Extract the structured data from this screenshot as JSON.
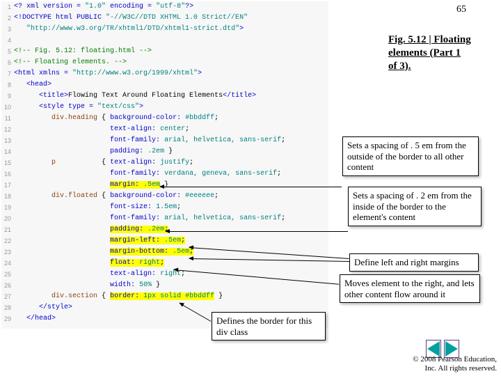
{
  "slide_number": "65",
  "figure_caption": "Fig. 5.12 | Floating elements (Part 1 of 3).",
  "code_lines": [
    {
      "n": "1",
      "html": "<span class='c-blue'>&lt;? xml version = </span><span class='c-teal'>\"1.0\"</span><span class='c-blue'> encoding = </span><span class='c-teal'>\"utf-8\"</span><span class='c-blue'>?&gt;</span>"
    },
    {
      "n": "2",
      "html": "<span class='c-blue'>&lt;!DOCTYPE html PUBLIC </span><span class='c-teal'>\"-//W3C//DTD XHTML 1.0 Strict//EN\"</span>"
    },
    {
      "n": "3",
      "html": "   <span class='c-teal'>\"http://www.w3.org/TR/xhtml1/DTD/xhtml1-strict.dtd\"</span><span class='c-blue'>&gt;</span>"
    },
    {
      "n": "4",
      "html": ""
    },
    {
      "n": "5",
      "html": "<span class='c-green'>&lt;!-- Fig. 5.12: floating.html --&gt;</span>"
    },
    {
      "n": "6",
      "html": "<span class='c-green'>&lt;!-- Floating elements. --&gt;</span>"
    },
    {
      "n": "7",
      "html": "<span class='c-blue'>&lt;html xmlns = </span><span class='c-teal'>\"http://www.w3.org/1999/xhtml\"</span><span class='c-blue'>&gt;</span>"
    },
    {
      "n": "8",
      "html": "   <span class='c-blue'>&lt;head&gt;</span>"
    },
    {
      "n": "9",
      "html": "      <span class='c-blue'>&lt;title&gt;</span><span class='c-black'>Flowing Text Around Floating Elements</span><span class='c-blue'>&lt;/title&gt;</span>"
    },
    {
      "n": "10",
      "html": "      <span class='c-blue'>&lt;style type = </span><span class='c-teal'>\"text/css\"</span><span class='c-blue'>&gt;</span>"
    },
    {
      "n": "11",
      "html": "         <span class='c-brown'>div.heading</span> <span class='c-black'>{</span> <span class='c-blue'>background-color:</span> <span class='c-teal'>#bbddff</span><span class='c-black'>;</span>"
    },
    {
      "n": "12",
      "html": "                       <span class='c-blue'>text-align:</span> <span class='c-teal'>center</span><span class='c-black'>;</span>"
    },
    {
      "n": "13",
      "html": "                       <span class='c-blue'>font-family:</span> <span class='c-teal'>arial, helvetica, sans-serif</span><span class='c-black'>;</span>"
    },
    {
      "n": "14",
      "html": "                       <span class='c-blue'>padding:</span> <span class='c-teal'>.2em</span> <span class='c-black'>}</span>"
    },
    {
      "n": "15",
      "html": "         <span class='c-brown'>p</span>           <span class='c-black'>{</span> <span class='c-blue'>text-align:</span> <span class='c-teal'>justify</span><span class='c-black'>;</span>"
    },
    {
      "n": "16",
      "html": "                       <span class='c-blue'>font-family:</span> <span class='c-teal'>verdana, geneva, sans-serif</span><span class='c-black'>;</span>"
    },
    {
      "n": "17",
      "html": "                       <span class='hl'><span class='c-blue'>margin:</span> <span class='c-teal'>.5em</span></span> <span class='c-black'>}</span>"
    },
    {
      "n": "18",
      "html": "         <span class='c-brown'>div.floated</span> <span class='c-black'>{</span> <span class='c-blue'>background-color:</span> <span class='c-teal'>#eeeeee</span><span class='c-black'>;</span>"
    },
    {
      "n": "19",
      "html": "                       <span class='c-blue'>font-size:</span> <span class='c-teal'>1.5em</span><span class='c-black'>;</span>"
    },
    {
      "n": "20",
      "html": "                       <span class='c-blue'>font-family:</span> <span class='c-teal'>arial, helvetica, sans-serif</span><span class='c-black'>;</span>"
    },
    {
      "n": "21",
      "html": "                       <span class='hl'><span class='c-blue'>padding:</span> <span class='c-teal'>.2em</span><span class='c-black'>;</span></span>"
    },
    {
      "n": "22",
      "html": "                       <span class='hl'><span class='c-blue'>margin-left:</span> <span class='c-teal'>.5em</span><span class='c-black'>;</span></span>"
    },
    {
      "n": "23",
      "html": "                       <span class='hl'><span class='c-blue'>margin-bottom:</span> <span class='c-teal'>.5em</span><span class='c-black'>;</span></span>"
    },
    {
      "n": "24",
      "html": "                       <span class='hl'><span class='c-blue'>float:</span> <span class='c-teal'>right</span><span class='c-black'>;</span></span>"
    },
    {
      "n": "25",
      "html": "                       <span class='c-blue'>text-align:</span> <span class='c-teal'>right</span><span class='c-black'>;</span>"
    },
    {
      "n": "26",
      "html": "                       <span class='c-blue'>width:</span> <span class='c-teal'>50%</span> <span class='c-black'>}</span>"
    },
    {
      "n": "27",
      "html": "         <span class='c-brown'>div.section</span> <span class='c-black'>{</span> <span class='hl'><span class='c-blue'>border:</span> <span class='c-teal'>1px solid #bbddff</span></span> <span class='c-black'>}</span>"
    },
    {
      "n": "28",
      "html": "      <span class='c-blue'>&lt;/style&gt;</span>"
    },
    {
      "n": "29",
      "html": "   <span class='c-blue'>&lt;/head&gt;</span>"
    }
  ],
  "annotations": {
    "a1": "Sets a spacing of . 5 em from the outside of the border to all other content",
    "a2": "Sets a spacing of . 2 em from the inside of the border to the element's content",
    "a3": "Define left and right margins",
    "a4": "Moves element to the right, and lets other content flow around it",
    "a5": "Defines the border for this div class"
  },
  "footer": {
    "line1": "© 2008 Pearson Education,",
    "line2": "Inc.  All rights reserved."
  },
  "nav": {
    "prev": "previous",
    "next": "next"
  }
}
